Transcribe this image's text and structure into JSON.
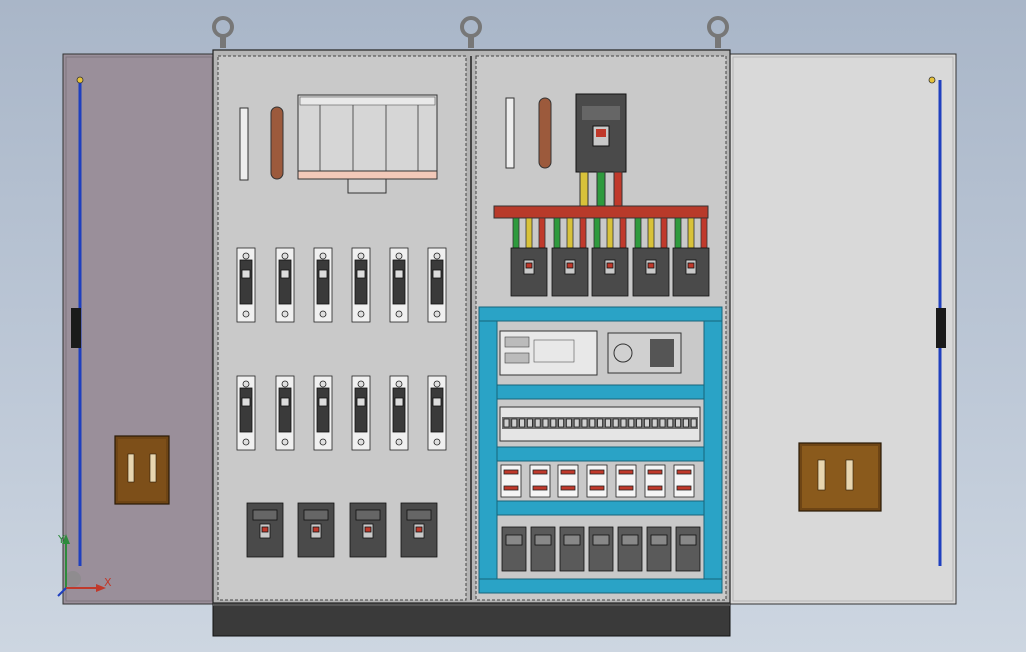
{
  "viewer": {
    "background_top": "#a9b6c8",
    "background_bottom": "#cdd6e1"
  },
  "triad": {
    "x_label": "X",
    "y_label": "Y",
    "x_color": "#c0392b",
    "y_color": "#2e8b3d",
    "z_color": "#1f3fbf"
  },
  "cabinet": {
    "panel_color": "#c9c9c9",
    "left_door_color": "#9a8f9a",
    "right_door_color": "#d9d9d9",
    "busbar_color": "#b83a2a",
    "din_section_color": "#2aa3c6",
    "plinth_color": "#3a3a3a",
    "icons": [
      "lifting-eye-icon",
      "door-handle-icon",
      "hinge-icon",
      "circuit-breaker-icon",
      "terminal-block-icon",
      "plc-icon",
      "power-supply-icon",
      "relay-icon",
      "busbar-icon"
    ]
  }
}
